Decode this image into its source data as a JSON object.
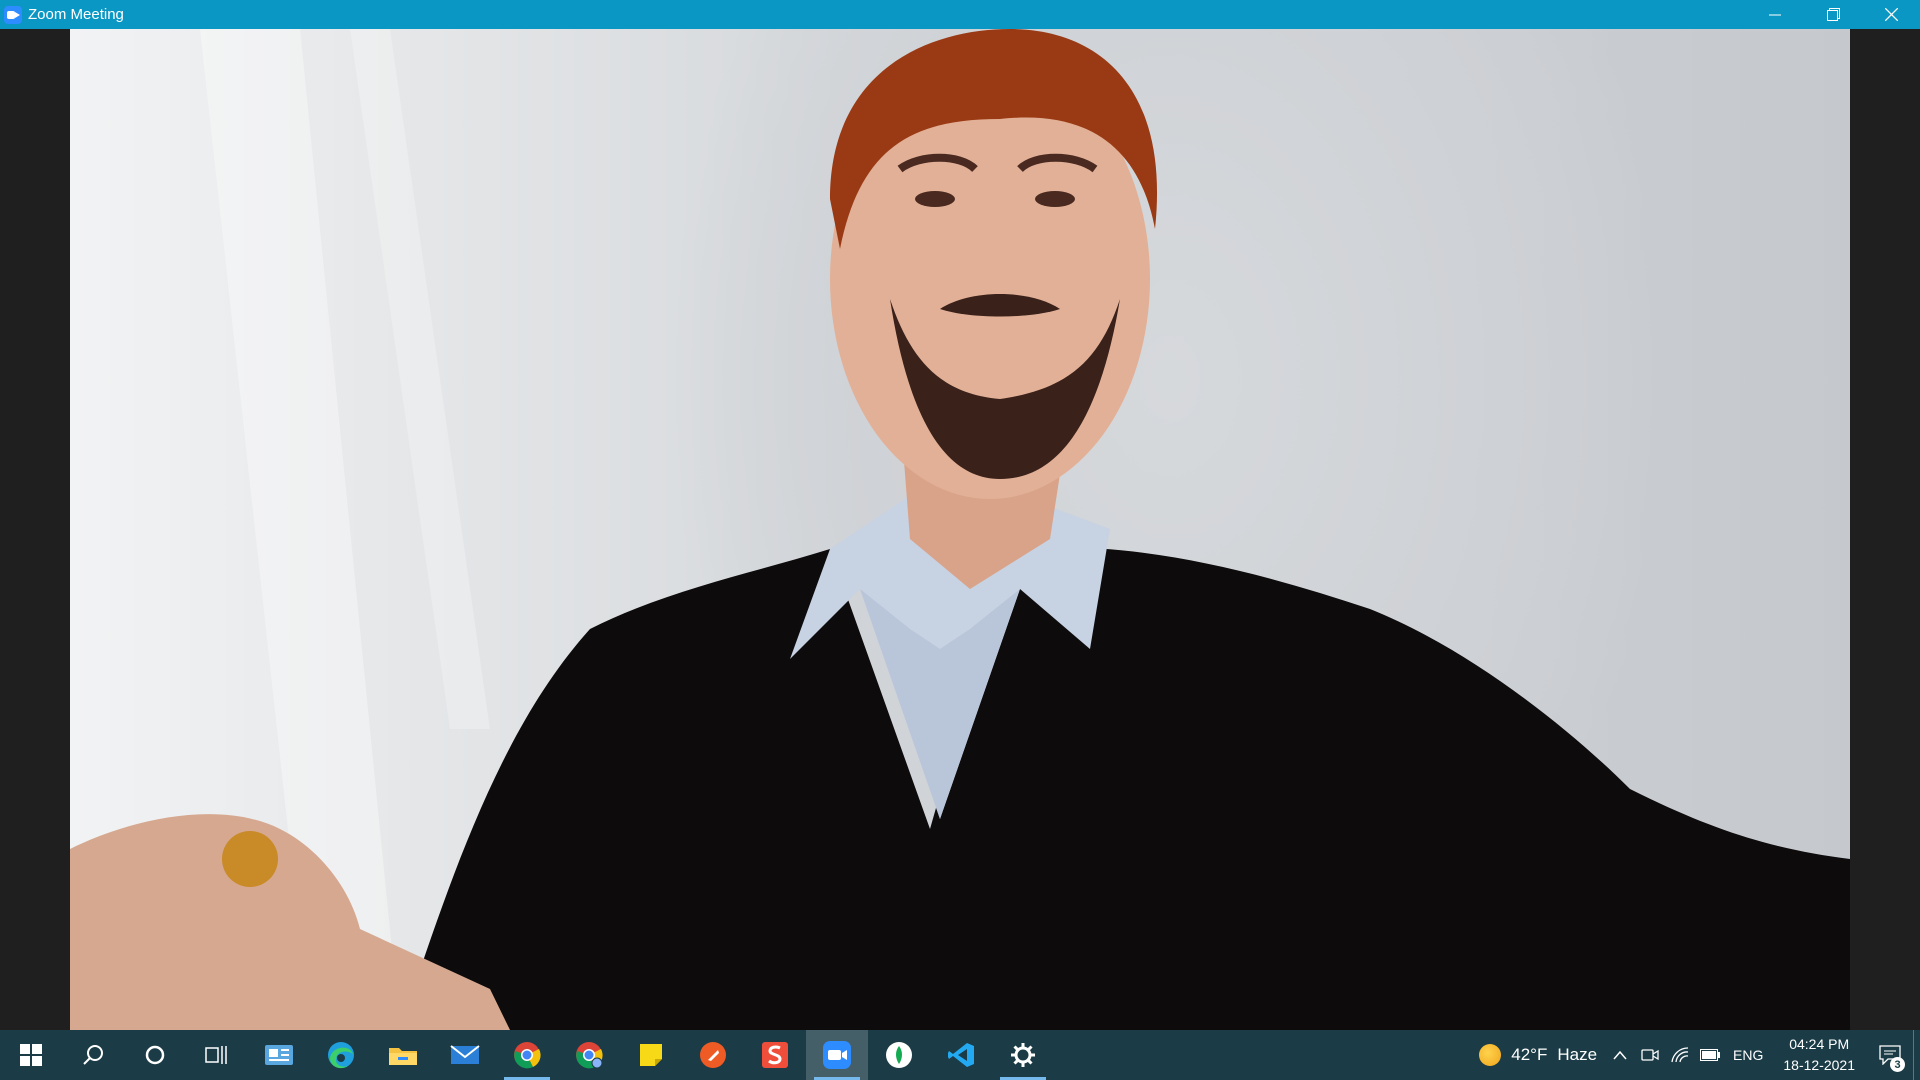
{
  "window": {
    "title": "Zoom Meeting",
    "minimize_glyph": "—",
    "restore_glyph": "❐",
    "close_glyph": "✕"
  },
  "video": {
    "feed_type": "self-view webcam",
    "subject": "man with beard wearing black v-neck sweater over light blue collared shirt"
  },
  "taskbar": {
    "left_items": [
      {
        "name": "start-button",
        "icon": "windows-logo-icon"
      },
      {
        "name": "search-button",
        "icon": "search-icon"
      },
      {
        "name": "cortana-button",
        "icon": "cortana-circle-icon"
      },
      {
        "name": "task-view-button",
        "icon": "task-view-icon"
      },
      {
        "name": "taskbar-app-news",
        "icon": "news-icon"
      },
      {
        "name": "taskbar-app-edge",
        "icon": "edge-icon"
      },
      {
        "name": "taskbar-app-file-explorer",
        "icon": "folder-icon"
      },
      {
        "name": "taskbar-app-mail",
        "icon": "mail-icon"
      },
      {
        "name": "taskbar-app-chrome",
        "icon": "chrome-icon",
        "active": true
      },
      {
        "name": "taskbar-app-chrome-profile",
        "icon": "chrome-profile-icon"
      },
      {
        "name": "taskbar-app-sticky-notes",
        "icon": "sticky-notes-icon"
      },
      {
        "name": "taskbar-app-postman",
        "icon": "postman-icon"
      },
      {
        "name": "taskbar-app-sublime",
        "icon": "sublime-icon"
      },
      {
        "name": "taskbar-app-zoom",
        "icon": "zoom-icon",
        "current": true
      },
      {
        "name": "taskbar-app-mongodb",
        "icon": "mongodb-icon"
      },
      {
        "name": "taskbar-app-vscode",
        "icon": "vscode-icon"
      },
      {
        "name": "taskbar-app-settings",
        "icon": "gear-icon",
        "active": true
      }
    ],
    "weather": {
      "temp": "42°F",
      "condition": "Haze"
    },
    "tray": {
      "chevron": "^",
      "language": "ENG"
    },
    "clock": {
      "time": "04:24 PM",
      "date": "18-12-2021"
    },
    "notifications": {
      "count": "3"
    }
  },
  "colors": {
    "titlebar": "#0b97c4",
    "taskbar": "#1b3c46",
    "zoom_blue": "#2d8cff"
  }
}
